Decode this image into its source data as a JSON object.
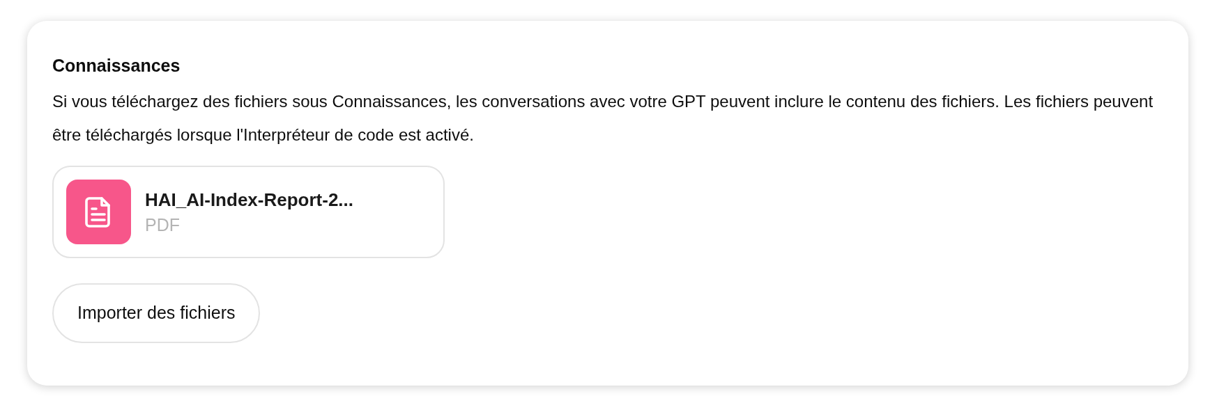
{
  "section": {
    "title": "Connaissances",
    "description": "Si vous téléchargez des fichiers sous Connaissances, les conversations avec votre GPT peuvent inclure le contenu des fichiers. Les fichiers peuvent être téléchargés lorsque l'Interpréteur de code est activé."
  },
  "files": [
    {
      "name": "HAI_AI-Index-Report-2...",
      "type": "PDF"
    }
  ],
  "upload_button": "Importer des fichiers"
}
